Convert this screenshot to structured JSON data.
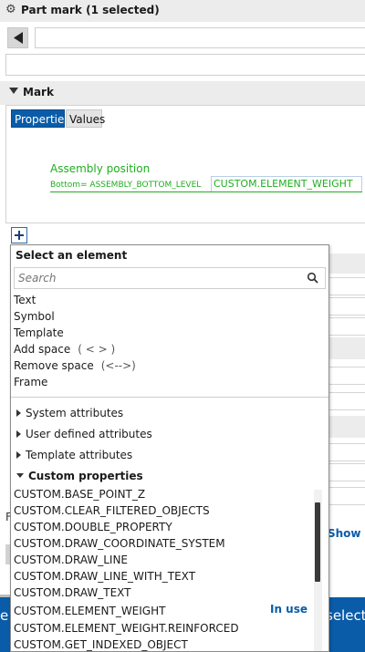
{
  "window": {
    "title": "Part mark (1 selected)"
  },
  "section": {
    "label": "Mark"
  },
  "tabs": [
    {
      "label": "Properties"
    },
    {
      "label": "Values"
    }
  ],
  "preview": {
    "line1": "Assembly position",
    "line2_left": "Bottom= ASSEMBLY_BOTTOM_LEVEL",
    "line2_field": "CUSTOM.ELEMENT_WEIGHT"
  },
  "popup": {
    "title": "Select an element",
    "search_placeholder": "Search",
    "elements": [
      {
        "label": "Text",
        "hint": ""
      },
      {
        "label": "Symbol",
        "hint": ""
      },
      {
        "label": "Template",
        "hint": ""
      },
      {
        "label": "Add space",
        "hint": "( < > )"
      },
      {
        "label": "Remove space",
        "hint": "(<-->)"
      },
      {
        "label": "Frame",
        "hint": ""
      }
    ],
    "groups": [
      {
        "label": "System attributes",
        "expanded": false
      },
      {
        "label": "User defined attributes",
        "expanded": false
      },
      {
        "label": "Template attributes",
        "expanded": false
      },
      {
        "label": "Custom properties",
        "expanded": true
      }
    ],
    "custom_properties": [
      "CUSTOM.BASE_POINT_Z",
      "CUSTOM.CLEAR_FILTERED_OBJECTS",
      "CUSTOM.DOUBLE_PROPERTY",
      "CUSTOM.DRAW_COORDINATE_SYSTEM",
      "CUSTOM.DRAW_LINE",
      "CUSTOM.DRAW_LINE_WITH_TEXT",
      "CUSTOM.DRAW_TEXT",
      "CUSTOM.ELEMENT_WEIGHT",
      "CUSTOM.ELEMENT_WEIGHT.REINFORCED",
      "CUSTOM.GET_INDEXED_OBJECT"
    ],
    "in_use_label": "In use"
  },
  "background": {
    "show_all": "Show al",
    "left_mark": "F",
    "bottom_left": "e",
    "bottom_right": "selecte"
  },
  "colors": {
    "accent": "#0a5ca8",
    "preview_green": "#1fae1f"
  },
  "icons": {
    "settings": "gear-icon",
    "back": "triangle-left-icon",
    "collapse": "triangle-down-icon",
    "add": "plus-icon",
    "search": "magnifier-icon"
  }
}
